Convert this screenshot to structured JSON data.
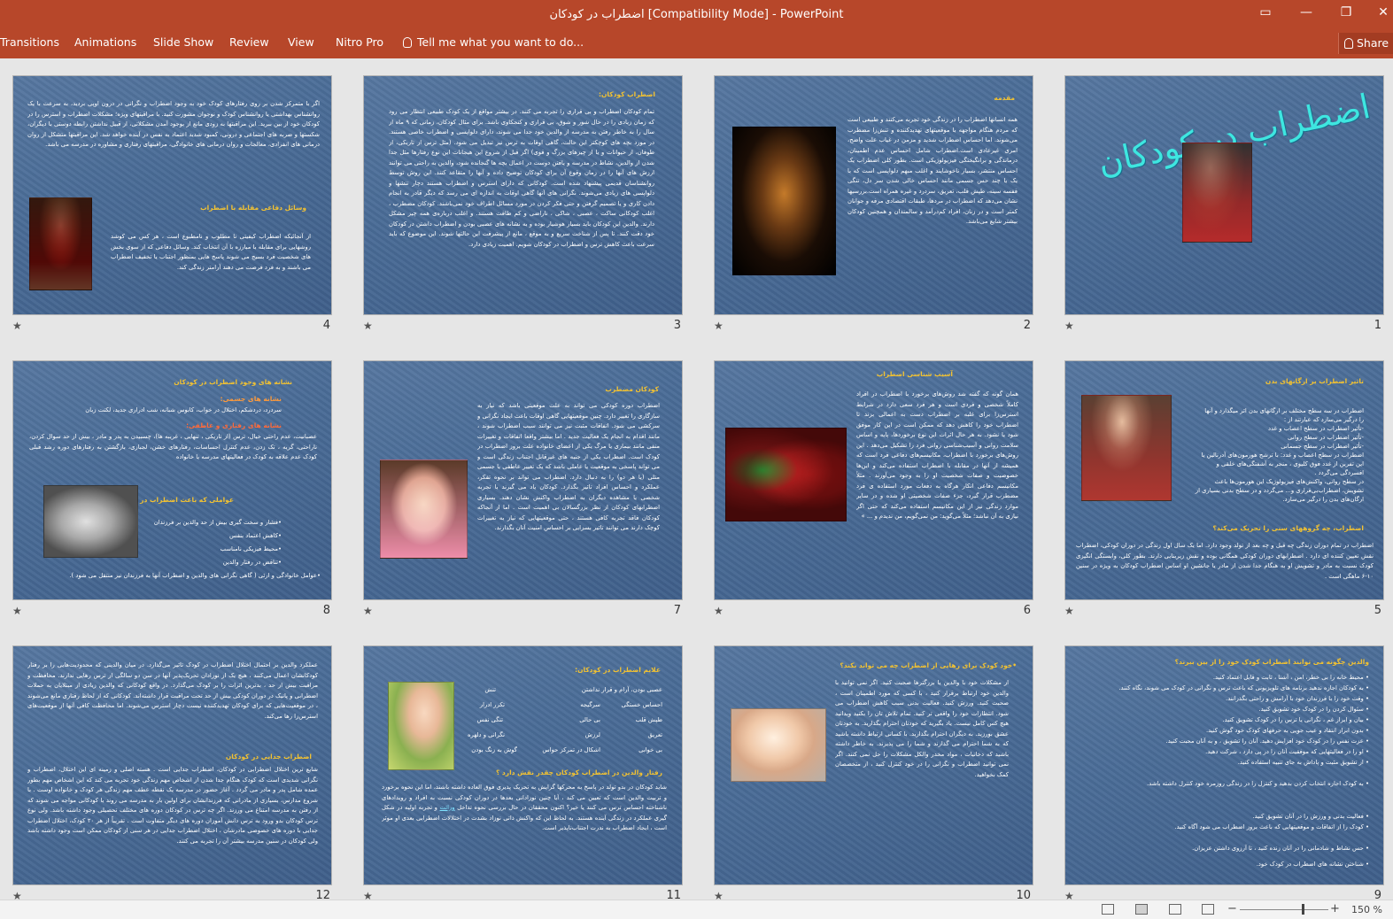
{
  "window": {
    "title": "اضطراب در کودکان [Compatibility Mode] - PowerPoint",
    "controls": [
      "ribbon-display-icon",
      "minimize-icon",
      "restore-icon",
      "close-icon"
    ]
  },
  "ribbon": {
    "tabs": [
      "Transitions",
      "Animations",
      "Slide Show",
      "Review",
      "View",
      "Nitro Pro"
    ],
    "tell_me": "Tell me what you want to do...",
    "share": "Share"
  },
  "slides": [
    {
      "num": "1",
      "title": "اضطراب در کودکان"
    },
    {
      "num": "2",
      "heading": "مقدمه",
      "text": "همه انسانها اضطراب را در زندگی خود تجربه می‌کنند و طبیعی است که مردم هنگام مواجهه با موقعیتهای تهدیدکننده و تنش‌زا مضطرب می‌شوند. اما احساس اضطراب شدید و مزمن در غیاب علت واضح، امری غیرعادی است.اضطراب شامل احساس عدم اطمینان، درماندگی و برانگیختگی فیزیولوژیکی است. بطور کلی اضطراب یک احساس منتشر، بسیار ناخوشایند و اغلب مبهم دلواپسی است که با یک یا چند حس جسمی مانند احساس خالی شدن سر دل، تنگی قفسه سینه، طپش قلب، تعریق، سردرد و غیره همراه است.بررسیها نشان می‌دهد که اضطراب در مردها، طبقات اقتصادی مرفه و جوانان کمتر است و در زنان، افراد کم‌درآمد و سالمندان و همچنین کودکان بیشتر شایع می‌باشد."
    },
    {
      "num": "3",
      "heading": "اضطراب کودکان:",
      "text": "تمام کودکان اضطراب و بی قراری را تجربه می کنند. در بیشتر مواقع از یک کودک طبیعی انتظار می رود که زمان زیادی را در حال شور و شوق، بی قراری و کنجکاوی باشد. برای مثال کودکان، زمانی که ۹ ماه از سال را به خاطر رفتن به مدرسه از والدین خود جدا می شوند، دارای دلواپسی و اضطراب خاصی هستند. در مورد بچه های کوچکتر این حالت، گاهی اوقات به ترس نیز تبدیل می شود. (مثل ترس از تاریکی، از طوفان، از حیوانات و یا از چیزهای بزرگ و قوی) اگر قبل از شروع این هیجانات این نوع رفتارها مثل جدا شدن از والدین، نشاط در مدرسه و یافتن دوست در اعمال بچه ها گنجانده شود، والدین به راحتی می توانند ارزش های آنها را در زمان وقوع آن برای کودکان توضیح داده و آنها را متقاعد کنند. این روش توسط روانشناسان قدیمی پیشنهاد شده است. کودکانی که دارای استرس و اضطراب هستند دچار تنشها و دلواپسی های زیادی می‌شوند. نگرانی های آنها گاهی اوقات به اندازه ای می رسد که دیگر قادر به انجام دادن کاری و یا تصمیم گرفتن و حتی فکر کردن در مورد مسائل اطراف خود نمی‌باشند. کودکان مضطرب ، اغلب کودکانی ساکت ، عصبی ، شاکی ، ناراضی و کم طاقت هستند. و اغلب درباره‌ی همه چیز مشکل دارند. والدین این کودکان باید بسیار هوشیار بوده و به نشانه های عصبی بودن و اضطراب داشتن در کودکان خود دقت کنند. تا پس از شناخت سریع و به موقع ، مانع از پیشرفت این حالتها شوند. این موضوع که باید سرعت باعث کاهش ترس و اضطراب در کودکان شویم. اهمیت زیادی دارد."
    },
    {
      "num": "4",
      "text": "اگر با متمرکز شدن بر روی رفتارهای کودک خود به وجود اضطراب و نگرانی در درون اوپی بردید، به سرعت با یک روانشناس بهداشتی یا روانشناس کودک و نوجوان مشورت کنید. با مراقبتهای ویژه؛ مشکلات اضطراب و استرس را در کودکان خود از بین ببرید. این مراقبتها به زودی مانع از بوجود آمدن مشکلاتی، از قبیل نداشتن رابطه دوستی با دیگران، شکستها و ضربه های اجتماعی و درونی، کمبود شدید اعتماد به نفس در آینده خواهد شد. این مراقبتها متشکل از روان درمانی های انفرادی، معالجات و روان درمانی های خانوادگی، مراقبتهای رفتاری و مشاوره در مدرسه می باشد.",
      "heading": "وسائل دفاعی مقابله با اضطراب",
      "text2": "از آنجائیکه اضطراب کیفیتی نا مطلوب و نامطبوع است ، هر کس می کوشد روشهایی برای مقابله با مبارزه با آن انتخاب کند. وسائل دفاعی که از سوی بخش های شخصیت فرد بسیج می شوند پاسخ هایی بمنظور اجتناب یا تخفیف اضطراب می باشند و به فرد فرصت می دهند آرامتر زندگی کند."
    },
    {
      "num": "5",
      "heading": "تاثیر اضطراب بر ارگانهای بدن",
      "lines": [
        "اضطراب در سه سطح مختلف بر ارگانهای بدن اثر میگذارد و آنها",
        "را درگیر می‌سازد که عبارتند از :",
        "-تأثیر اضطراب در سطح اعصاب و غدد",
        "-تأثیر اضطراب در سطح روانی",
        "-تأثیر اضطراب در سطح جسمانی",
        "اضطراب در سطح اعصاب و غدد: با ترشح هورمون‌های آدرنالین یا",
        "این تفرین از غدد فوق کلیوی ، منجر به آشفتگی‌های خلقی و",
        "افسردگی می‌گردد .",
        "در سطح روانی، واکنش‌های فیزیولوژیک این هورمون‌ها باعث",
        "تشویش، اضطراب‌بی‌قراری و... می‌گردد و در سطح بدنی بسیاری از",
        "ارگان‌های بدن را درگیر می‌سازد."
      ],
      "heading2": "اضطراب، چه گروههای سنی را تحریک می‌کند؟",
      "text2": "اضطراب در تمام دوران زندگی چه قبل و چه بعد از تولد وجود دارد. اما یک سال اول زندگی در دوران کودکی، اضطراب نقش تعیین کننده ای دارد . اضطرابهای دوران کودکی همگانی بوده و نقش زیربنایی دارند. بطور کلی، وابستگی انگیزی کودک نسبت به مادر و تشویش او به هنگام جدا شدن از مادر یا جانشین او اساس اضطراب کودکان به ویژه در سنین ۱۰-۶ ماهگی است ."
    },
    {
      "num": "6",
      "heading": "آسیب شناسی اضطراب",
      "text": "همان گونه که گفته شد روش‌های برخورد با اضطراب در افراد کاملاً شخصی و فردی است و هر فرد سعی دارد در شرایط استرس‌زا برای غلبه بر اضطراب دست به اعمالی بزند تا اضطراب خود را کاهش دهد که ممکن است در این کار موفق شود یا نشود. به هر حال اثرات این نوع برخوردها، پایه و اساس سلامت روانی و آسیب‌شناسی روانی فرد را تشکیل می‌دهد . این روش‌های برخورد با اضطراب، مکانیسم‌های دفاعی فرد است که همیشه از آنها در مقابله با اضطراب استفاده می‌کند و این‌ها خصوصیت و صفات شخصیت او را به وجود می‌آورند . مثلاً مکانیسم دفاعی انکار هرگاه به دفعات مورد استفاده ی فرد مضطرب قرار گیرد، جزء صفات شخصیتی او شده و در سایر موارد زندگی نیز از این مکانیسم استفاده می‌کند که حتی اگر نیازی به آن نباشد؛ مثلاً می‌گوید: من نمی‌گویم، من ندیدم و ... »"
    },
    {
      "num": "7",
      "heading": "کودکان مضطرب",
      "text": "اضطراب دوره کودکی می تواند به علت موقعیتی باشد که نیاز به سازگاری را تغییر دارد. چنین موقعیتهایی گاهی اوقات باعث ایجاد نگرانی و سرکشی می شود. اتفاقات مثبت نیز می توانند سبب اضطراب شوند ، مانند اقدام به انجام یک فعالیت جدید . اما بیشتر واقعا اتفاقات و تغییرات منفی مانند بیماری یا مرگ یکی از اعضای خانواده علت بروز اضطراب در کودک است. اضطراب یکی از جنبه های غیرقابل اجتناب زندگی است و می تواند پاسخی به موقعیت یا عاملی باشد که یک تغییر عاطفی یا جسمی متلی (یا هر دو) را به دنبال دارد. اضطراب می تواند بر نحوه تفکر، عملکرد و احساس افراد تاثیر بگذارد. کودکان یاد می گیرند با تجربه شخصی یا مشاهده دیگران به اضطراب واکنش نشان دهند. بسیاری اضطرابهای کودکان از نظر بزرگسالان بی اهمیت است . اما از آنجاکه کودکان فاقد تجربه کافی هستند ، حتی موقعیتهایی که نیاز به تغییرات کوچک دارند می توانند تاثیر بسزایی بر احساس امنیت آنان بگذارند."
    },
    {
      "num": "8",
      "heading": "نشانه های وجود اضطراب در کودکان",
      "sub1": "نشانه های جسمی:",
      "text1": "سردرد، دردشکم، اختلال در خواب، کابوس شبانه، شب ادراری جدید، لکنت زبان",
      "sub2": "نشانه های رفتاری و عاطفی:",
      "text2": "عصبانیت، عدم راحتی خیال، ترس (از تاریکی ، تنهایی ، غریبه ها)، چسبیدن به پدر و مادر ، بیش از حد سوال کردن، ناراحتی، گریه ، تک زدن، عدم کنترل احساسات، رفتارهای خشن، لجبازی، بازگشتن به رفتارهای دوره رشد قبلی کودک عدم علاقه به کودک در فعالیتهای مدرسه یا خانواده",
      "sub3": "عواملی که باعث اضطراب در کودکان می شود :",
      "items": [
        "•فشار و سخت گیری بیش از حد والدین بر فرزندان",
        "•کاهش اعتماد بنفس",
        "•محیط فیزیکی نامناسب",
        "•تناقض در رفتار والدین",
        "•عوامل خانوادگی و ارثی ( گاهی نگرانی های والدین و اضطراب آنها به فرزندان نیز منتقل می شود )."
      ]
    },
    {
      "num": "9",
      "heading": "والدین چگونه می توانند اضطراب کودک خود را از بین ببرند؟",
      "items": [
        "• محیط خانه را بی خطر، امن ، آشنا ، ثابت و قابل اعتماد کنید.",
        "• به کودکان اجازه ندهید برنامه های تلویزیونی که باعث ترس و نگرانی در کودک می شوند، نگاه کنند.",
        "• وقت خود را با فرزندان خود با آرامش و راحتی بگذرانند.",
        "• سئوال کردن را در کودک خود تشویق کنید.",
        "• بیان و ابراز غم ، نگرانی یا ترس را در کودک تشویق کنید.",
        "• بدون ابراز انتقاد و عیب جویی به حرفهای کودک خود گوش کنید.",
        "• عزت نفس را در کودک خود افزایش دهید. آنان را تشویق ، و به آنان محبت کنید.",
        "• او را در فعالیتهایی که موفقیت آنان را در پی دارد ، شرکت دهید.",
        "• از تشویق مثبت و پاداش به جای تنبیه استفاده کنید.",
        "• به کودک اجازه انتخاب کردن بدهید و کنترل را در زندگی روزمره خود کنترل داشته باشد.",
        "• فعالیت بدنی و ورزش را در آنان تشویق کنید.",
        "• کودک را از اتفاقات و موقعیتهایی که باعث بروز اضطراب می شود آگاه کنید.",
        "• حس نشاط و شادمانی را در آنان زنده کنید ، تا آرزوی داشتن عزیزان.",
        "• شناختن نشانه های اضطراب در کودک خود."
      ]
    },
    {
      "num": "10",
      "heading": "•خود کودک برای رهایی از اضطراب چه می تواند بکند؟",
      "text": "از مشکلات خود با والدین یا بزرگترها صحبت کنید. اگر نمی توانید با والدین خود ارتباط برقرار کنید ، با کسی که مورد اطمینان است ، صحبت کنید. ورزش کنید. فعالیت بدنی سبب کاهش اضطراب می شود. انتظارات خود را واقعی تر کنید. تمام تلاش تان را بکنید وبدانید هیچ کس کامل نیست. یاد بگیرید که خودتان احترام بگذارید. به خودتان عشق بورزید. به دیگران احترام بگذارید. با کسانی ارتباط داشته باشید که به شما احترام می گذارند و شما را می پذیرند. به خاطر داشته باشید که دخانیات ، مواد مخدر والکل مشکلات را حل نمی کنند. اگر نمی توانید اضطراب و نگرانی را در خود کنترل کنید ، از متخصصان کمک بخواهید."
    },
    {
      "num": "11",
      "heading": "علایم اضطراب در کودکان:",
      "symptoms": [
        "تنش",
        "عصبی بودن، آرام و قرار نداشتن",
        "تکرر ادرار",
        "سرگیجه",
        "احساس خستگی",
        "تنگی نفس",
        "بی حالی",
        "طپش قلب",
        "نگرانی و دلهره",
        "لرزش",
        "تعریق",
        "گوش به زنگ بودن",
        "اشکال در تمرکز حواس",
        "بی خوابی"
      ],
      "heading2": "رفتار والدین در اضطراب کودکان چقدر نقش دارد ؟",
      "text2": "شاید کودکان در بدو تولد در پاسخ به محرکها گرایش به تحریک پذیری فوق العاده داشته باشند، اما این نحوه برخورد و تربیت والدین است که تعیین می کند ، آیا چنین نوزادانی بعدها در دوران کودکی نسبت به افراد و رویدادهای ناشناخته احساس ترس می کنند یا خیر؟ اکنون محققان در حال بررسی نحوه تداخل",
      "link": "وراثت",
      "text3": "و تجربه اولیه در شکل گیری عملکرد در زندگی آینده هستند. به لحاظ این که واکنش ذاتی نوزاد بشدت در اختلالات اضطرابی بعدی او موثر است ، ایجاد اضطراب به ندرت اجتناب‌ناپذیر است."
    },
    {
      "num": "12",
      "text": "عملکرد والدین بر احتمال اختلال اضطراب در کودک تاثیر می‌گذارد. در میان والدینی که محدودیت‌هایی را بر رفتار کودکانشان اعمال می‌کنند ، هیچ یک از نوزادان تحریک‌پذیر آنها در سن دو سالگی از ترس رهایی ندارند. محافظت و مراقبت بیش از حد ، بدترین اثرات را بر کودک می‌گذارد. در واقع کودکانی که والدین زیادی از مبتلایان به حملات اضطرابی و پانیک در دوران کودکی بیش از حد تحت مراقبت قرار داشته‌اند. کودکانی که از لحاظ رفتاری مانع می‌شوند ، در موقعیت‌هایی که برای کودکان تهدیدکننده نیست دچار استرس می‌شوند. اما محافظت کافی آنها از موقعیت‌های استرس‌زا رها می‌کند.",
      "heading": "اضطراب جدایی در کودکان",
      "text2": "شایع ترین اختلال اضطرابی در کودکان، اضطراب جدایی است . هسته اصلی و زمینه ای این اختلال، اضطراب و نگرانی شدیدی است که کودک هنگام جدا شدن از اشخاص مهم زندگی خود تجربه می کند که این اشخاص مهم بطور عمده شامل پدر و مادر می گردد . آغاز حضور در مدرسه یک نقطه عطف مهم زندگی هر کودک و خانواده اوست . با شروع مدارس، بسیاری از مادرانی که فرزندانشان برای اولین بار به مدرسه می روند با کودکانی مواجه می شوند که از رفتن به مدرسه امتناع می ورزند. اگر چه ترس در کودکان دوره های مختلف تحصیلی وجود داشته باشد. ولی نوع ترس کودکان بدو ورود به ترس دانش آموزان دوره های دیگر متفاوت است . تقریباً از هر ۲۰ کودک، اختلال اضطراب جدایی با دوره های خصوصی مادرشان ، اختلال اضطراب جدایی در هر سنی از کودکان ممکن است وجود داشته باشد ولی کودکان در سنین مدرسه بیشتر آن را تجربه می کنند."
    }
  ],
  "statusbar": {
    "zoom": "150 %",
    "view_icons": [
      "normal-view-icon",
      "slide-sorter-icon",
      "reading-view-icon",
      "slide-show-icon"
    ]
  }
}
